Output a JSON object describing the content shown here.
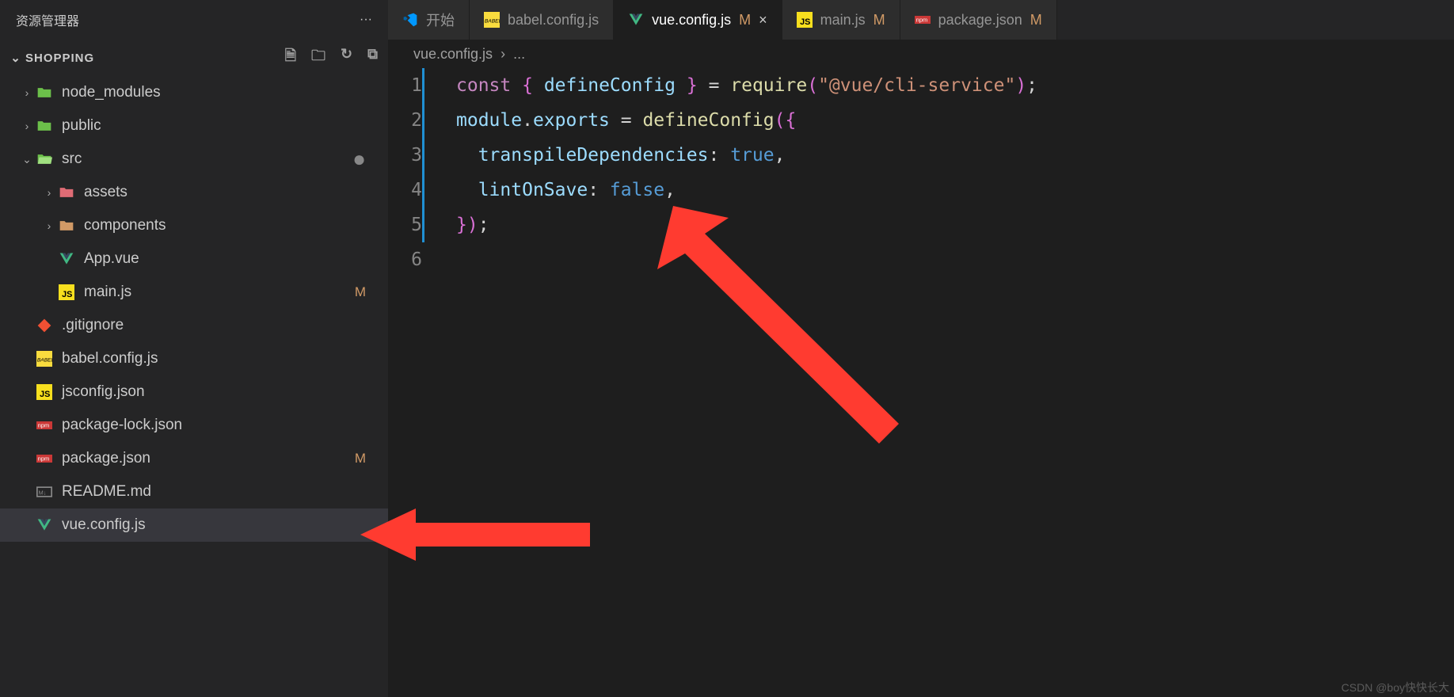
{
  "sidebar": {
    "title": "资源管理器",
    "more": "···",
    "project": "SHOPPING",
    "items": [
      {
        "label": "node_modules",
        "indent": 0,
        "chevron": "›",
        "icon": "folder-green",
        "interact": true
      },
      {
        "label": "public",
        "indent": 0,
        "chevron": "›",
        "icon": "folder-green",
        "interact": true
      },
      {
        "label": "src",
        "indent": 0,
        "chevron": "⌄",
        "icon": "folder-open-green",
        "dot": "●",
        "interact": true
      },
      {
        "label": "assets",
        "indent": 1,
        "chevron": "›",
        "icon": "folder-red",
        "interact": true
      },
      {
        "label": "components",
        "indent": 1,
        "chevron": "›",
        "icon": "folder-yellow",
        "interact": true
      },
      {
        "label": "App.vue",
        "indent": 1,
        "icon": "vue",
        "interact": true
      },
      {
        "label": "main.js",
        "indent": 1,
        "icon": "js",
        "badge": "M",
        "interact": true
      },
      {
        "label": ".gitignore",
        "indent": 0,
        "icon": "git",
        "interact": true
      },
      {
        "label": "babel.config.js",
        "indent": 0,
        "icon": "babel",
        "interact": true
      },
      {
        "label": "jsconfig.json",
        "indent": 0,
        "icon": "js-gear",
        "interact": true
      },
      {
        "label": "package-lock.json",
        "indent": 0,
        "icon": "npm",
        "interact": true
      },
      {
        "label": "package.json",
        "indent": 0,
        "icon": "npm",
        "badge": "M",
        "interact": true
      },
      {
        "label": "README.md",
        "indent": 0,
        "icon": "md",
        "interact": true
      },
      {
        "label": "vue.config.js",
        "indent": 0,
        "icon": "vue-gear",
        "active": true,
        "interact": true
      }
    ]
  },
  "tabs": [
    {
      "label": "开始",
      "icon": "vscode",
      "interact": true
    },
    {
      "label": "babel.config.js",
      "icon": "babel",
      "interact": true
    },
    {
      "label": "vue.config.js",
      "icon": "vue-gear",
      "status": "M",
      "close": "×",
      "active": true,
      "interact": true
    },
    {
      "label": "main.js",
      "icon": "js",
      "status": "M",
      "interact": true
    },
    {
      "label": "package.json",
      "icon": "npm",
      "status": "M",
      "last": true,
      "interact": true
    }
  ],
  "breadcrumb": {
    "file": "vue.config.js",
    "sep": "›",
    "more": "..."
  },
  "code": {
    "lines": [
      {
        "n": "1",
        "mod": true,
        "tokens": [
          [
            "kw",
            "const"
          ],
          [
            "pl",
            " "
          ],
          [
            "br",
            "{"
          ],
          [
            "pl",
            " "
          ],
          [
            "var",
            "defineConfig"
          ],
          [
            "pl",
            " "
          ],
          [
            "br",
            "}"
          ],
          [
            "pl",
            " = "
          ],
          [
            "fn",
            "require"
          ],
          [
            "br",
            "("
          ],
          [
            "str",
            "\"@vue/cli-service\""
          ],
          [
            "br",
            ")"
          ],
          [
            "pl",
            ";"
          ]
        ]
      },
      {
        "n": "2",
        "mod": true,
        "tokens": [
          [
            "var",
            "module"
          ],
          [
            "pl",
            "."
          ],
          [
            "var",
            "exports"
          ],
          [
            "pl",
            " = "
          ],
          [
            "fn",
            "defineConfig"
          ],
          [
            "br",
            "("
          ],
          [
            "br",
            "{"
          ]
        ]
      },
      {
        "n": "3",
        "mod": true,
        "tokens": [
          [
            "pl",
            "  "
          ],
          [
            "var",
            "transpileDependencies"
          ],
          [
            "pl",
            ": "
          ],
          [
            "const",
            "true"
          ],
          [
            "pl",
            ","
          ]
        ]
      },
      {
        "n": "4",
        "mod": true,
        "tokens": [
          [
            "pl",
            "  "
          ],
          [
            "var",
            "lintOnSave"
          ],
          [
            "pl",
            ": "
          ],
          [
            "const",
            "false"
          ],
          [
            "pl",
            ","
          ]
        ]
      },
      {
        "n": "5",
        "mod": true,
        "tokens": [
          [
            "br",
            "}"
          ],
          [
            "br",
            ")"
          ],
          [
            "pl",
            ";"
          ]
        ]
      },
      {
        "n": "6",
        "tokens": []
      }
    ]
  },
  "watermark": "CSDN @boy快快长大"
}
